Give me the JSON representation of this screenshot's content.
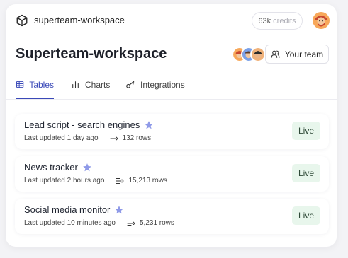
{
  "topbar": {
    "workspace_name": "superteam-workspace",
    "credits_value": "63k",
    "credits_unit": "credits"
  },
  "page": {
    "title": "Superteam-workspace",
    "team_button_label": "Your team"
  },
  "tabs": [
    {
      "label": "Tables",
      "icon": "table-icon",
      "active": true
    },
    {
      "label": "Charts",
      "icon": "bar-chart-icon",
      "active": false
    },
    {
      "label": "Integrations",
      "icon": "key-icon",
      "active": false
    }
  ],
  "tables": [
    {
      "name": "Lead script - search engines",
      "updated": "Last updated 1 day ago",
      "rows": "132 rows",
      "status": "Live"
    },
    {
      "name": "News tracker",
      "updated": "Last updated 2 hours ago",
      "rows": "15,213 rows",
      "status": "Live"
    },
    {
      "name": "Social media monitor",
      "updated": "Last updated 10 minutes ago",
      "rows": "5,231 rows",
      "status": "Live"
    }
  ],
  "colors": {
    "accent": "#3a49b8",
    "live_bg": "#e8f6ec",
    "star": "#8f9ae8"
  }
}
